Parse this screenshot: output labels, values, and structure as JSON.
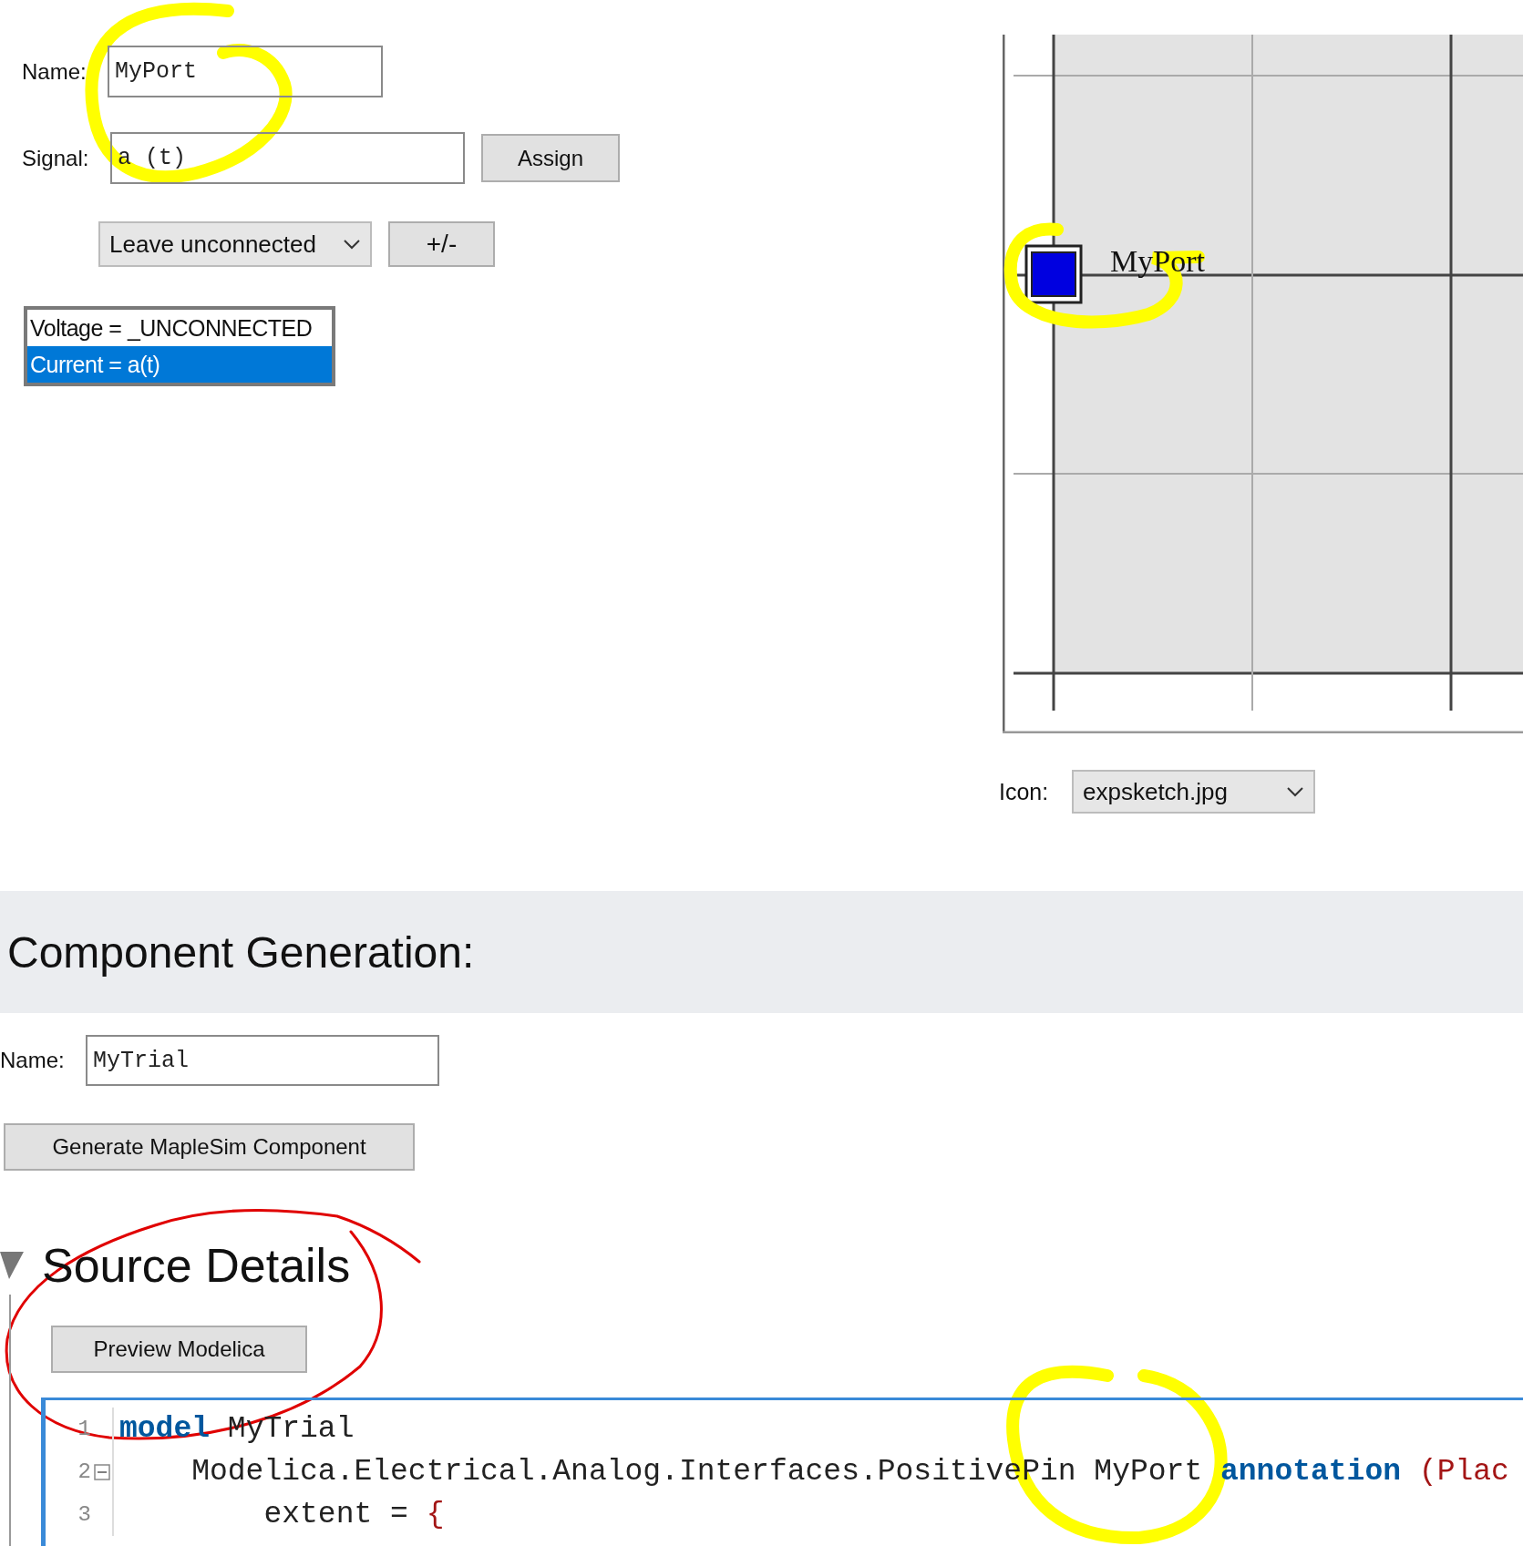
{
  "port_editor": {
    "name_label": "Name:",
    "name_value": "MyPort",
    "signal_label": "Signal:",
    "signal_value": "a (t)",
    "assign_button": "Assign",
    "connection_dropdown": "Leave unconnected",
    "sign_button": "+/-",
    "assignments": [
      {
        "text": "Voltage = _UNCONNECTED",
        "selected": false
      },
      {
        "text": "Current = a(t)",
        "selected": true
      }
    ]
  },
  "icon_preview": {
    "port_label": "MyPort",
    "icon_label": "Icon:",
    "icon_dropdown": "expsketch.jpg"
  },
  "component_generation": {
    "title": "Component Generation:",
    "name_label": "Name:",
    "name_value": "MyTrial",
    "generate_button": "Generate MapleSim Component"
  },
  "source_details": {
    "title": "Source Details",
    "expanded": true,
    "preview_button": "Preview Modelica",
    "code_lines": [
      {
        "number": "1",
        "foldable": false,
        "tokens": [
          {
            "kind": "keyword",
            "text": "model"
          },
          {
            "kind": "plain",
            "text": " MyTrial"
          }
        ]
      },
      {
        "number": "2",
        "foldable": true,
        "tokens": [
          {
            "kind": "plain",
            "text": "    Modelica.Electrical.Analog.Interfaces.PositivePin MyPort "
          },
          {
            "kind": "keyword",
            "text": "annotation"
          },
          {
            "kind": "punct",
            "text": " (Plac"
          }
        ]
      },
      {
        "number": "3",
        "foldable": false,
        "tokens": [
          {
            "kind": "plain",
            "text": "        extent = "
          },
          {
            "kind": "punct",
            "text": "{"
          }
        ]
      }
    ]
  }
}
